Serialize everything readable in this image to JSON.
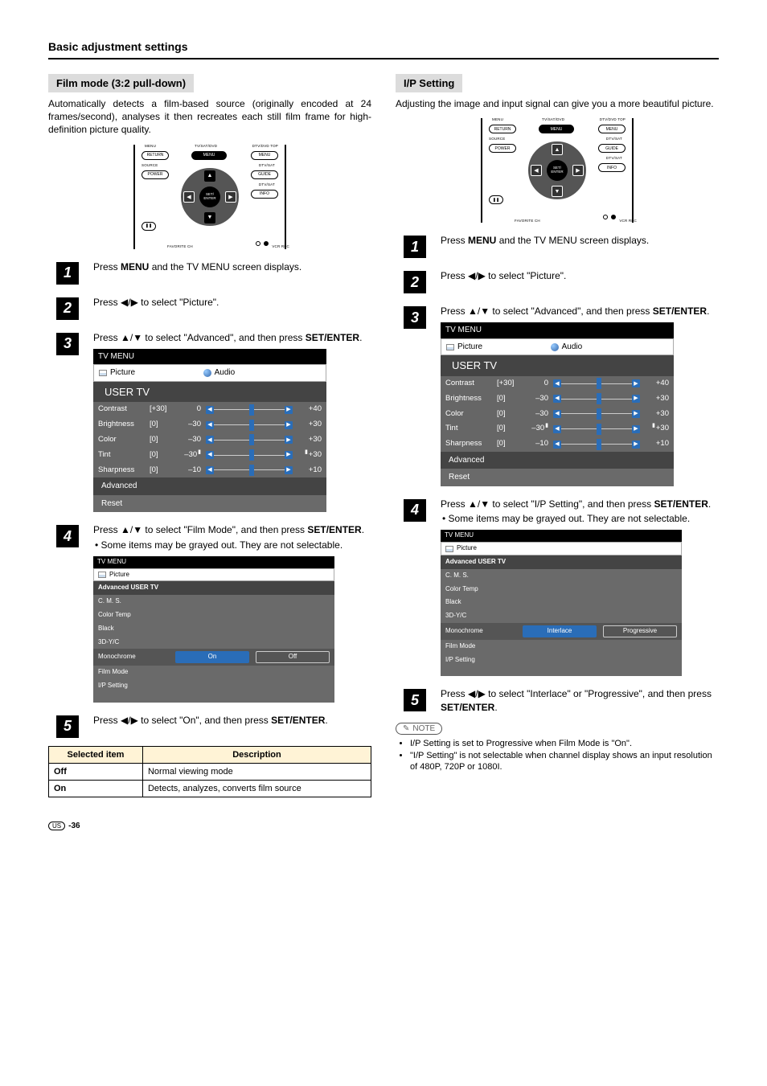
{
  "page": {
    "section_title": "Basic adjustment settings",
    "locale": "US",
    "page_suffix": "-36"
  },
  "left": {
    "heading": "Film mode (3:2 pull-down)",
    "intro": "Automatically detects a film-based source (originally encoded at 24 frames/second), analyses it then recreates each still film frame for high-definition picture quality.",
    "remote": {
      "top_labels": [
        "MENU",
        "TV/SAT/DVD",
        "DTV/DVD TOP"
      ],
      "row1": [
        "RETURN",
        "MENU",
        "MENU"
      ],
      "row2_left": "SOURCE",
      "row2_right": "DTV/SAT",
      "row3_left": "POWER",
      "row3_right": "GUIDE",
      "row4_right": "DTV/SAT",
      "row5_right": "INFO",
      "bottom": "FAVORITE CH",
      "bottom_right": "VCR REC",
      "center": "SET/\nENTER",
      "active_pill": 1,
      "highlight_arrows": [
        "left",
        "right"
      ]
    },
    "steps": [
      {
        "n": "1",
        "text_before": "Press ",
        "bold": "MENU",
        "text_after": " and the TV MENU screen displays."
      },
      {
        "n": "2",
        "pieces": [
          "Press ",
          "◀",
          "/",
          "▶",
          " to select \"Picture\"."
        ]
      },
      {
        "n": "3",
        "pieces_line1": [
          "Press ",
          "▲",
          "/",
          "▼",
          " to select \"Advanced\", and then press "
        ],
        "bold2": "SET/ENTER",
        "after2": "."
      },
      {
        "n": "4",
        "pieces_line1": [
          "Press ",
          "▲",
          "/",
          "▼",
          " to select \"Film Mode\", and then press "
        ],
        "bold2": "SET/ENTER",
        "after2": ".",
        "bullet": "Some items may be grayed out. They are not selectable."
      },
      {
        "n": "5",
        "pieces": [
          "Press ",
          "◀",
          "/",
          "▶",
          " to select \"On\", and then press "
        ],
        "bold2": "SET/ENTER",
        "after2": "."
      }
    ],
    "tv_menu": {
      "title": "TV MENU",
      "tab1": "Picture",
      "tab2": "Audio",
      "user": "USER TV",
      "rows": [
        {
          "label": "Contrast",
          "br": "[+30]",
          "neg": "0",
          "pos": "+40"
        },
        {
          "label": "Brightness",
          "br": "[0]",
          "neg": "–30",
          "pos": "+30"
        },
        {
          "label": "Color",
          "br": "[0]",
          "neg": "–30",
          "pos": "+30"
        },
        {
          "label": "Tint",
          "br": "[0]",
          "neg": "–30",
          "pos": "+30",
          "caps": true
        },
        {
          "label": "Sharpness",
          "br": "[0]",
          "neg": "–10",
          "pos": "+10"
        }
      ],
      "plain": [
        "Advanced",
        "Reset"
      ]
    },
    "adv_menu": {
      "title": "TV MENU",
      "tab1": "Picture",
      "head": "Advanced USER TV",
      "rows": [
        "C. M. S.",
        "Color Temp",
        "Black",
        "3D-Y/C",
        "Monochrome",
        "Film Mode",
        "I/P Setting"
      ],
      "sel_index": 4,
      "options": [
        "On",
        "Off"
      ],
      "selected": 0
    },
    "table": {
      "h1": "Selected item",
      "h2": "Description",
      "rows": [
        {
          "a": "Off",
          "b": "Normal viewing mode"
        },
        {
          "a": "On",
          "b": "Detects, analyzes, converts film source"
        }
      ]
    }
  },
  "right": {
    "heading": "I/P Setting",
    "intro": "Adjusting the image and input signal can give you a more beautiful picture.",
    "remote": {
      "top_labels": [
        "MENU",
        "TV/SAT/DVD",
        "DTV/DVD TOP"
      ],
      "row1": [
        "RETURN",
        "MENU",
        "MENU"
      ],
      "row2_left": "SOURCE",
      "row2_right": "DTV/SAT",
      "row3_left": "POWER",
      "row3_right": "GUIDE",
      "row4_right": "DTV/SAT",
      "row5_right": "INFO",
      "bottom": "FAVORITE CH",
      "bottom_right": "VCR REC",
      "center": "SET/\nENTER",
      "active_pill": 1,
      "highlight_arrows": [
        "up",
        "down",
        "left",
        "right"
      ]
    },
    "steps": [
      {
        "n": "1",
        "text_before": "Press ",
        "bold": "MENU",
        "text_after": " and the TV MENU screen displays."
      },
      {
        "n": "2",
        "pieces": [
          "Press ",
          "◀",
          "/",
          "▶",
          " to select \"Picture\"."
        ]
      },
      {
        "n": "3",
        "pieces_line1": [
          "Press ",
          "▲",
          "/",
          "▼",
          " to select \"Advanced\", and then press "
        ],
        "bold2": "SET/ENTER",
        "after2": "."
      },
      {
        "n": "4",
        "pieces_line1": [
          "Press ",
          "▲",
          "/",
          "▼",
          " to select \"I/P Setting\", and then press "
        ],
        "bold2": "SET/ENTER",
        "after2": ".",
        "bullet": "Some items may be grayed out. They are not selectable."
      },
      {
        "n": "5",
        "pieces": [
          "Press ",
          "◀",
          "/",
          "▶",
          " to select \"Interlace\" or \"Progressive\", and then press "
        ],
        "bold2": "SET/ENTER",
        "after2": "."
      }
    ],
    "tv_menu": {
      "title": "TV MENU",
      "tab1": "Picture",
      "tab2": "Audio",
      "user": "USER TV",
      "rows": [
        {
          "label": "Contrast",
          "br": "[+30]",
          "neg": "0",
          "pos": "+40"
        },
        {
          "label": "Brightness",
          "br": "[0]",
          "neg": "–30",
          "pos": "+30"
        },
        {
          "label": "Color",
          "br": "[0]",
          "neg": "–30",
          "pos": "+30"
        },
        {
          "label": "Tint",
          "br": "[0]",
          "neg": "–30",
          "pos": "+30",
          "caps": true
        },
        {
          "label": "Sharpness",
          "br": "[0]",
          "neg": "–10",
          "pos": "+10"
        }
      ],
      "plain": [
        "Advanced",
        "Reset"
      ]
    },
    "adv_menu": {
      "title": "TV MENU",
      "tab1": "Picture",
      "head": "Advanced USER TV",
      "rows": [
        "C. M. S.",
        "Color Temp",
        "Black",
        "3D-Y/C",
        "Monochrome",
        "Film Mode",
        "I/P Setting"
      ],
      "sel_index": 4,
      "options": [
        "Interlace",
        "Progressive"
      ],
      "selected": 0
    },
    "note_label": "NOTE",
    "note_items": [
      "I/P Setting is set to Progressive when Film Mode is \"On\".",
      "\"I/P Setting\" is not selectable when channel display shows an input resolution of 480P, 720P or 1080I."
    ]
  }
}
